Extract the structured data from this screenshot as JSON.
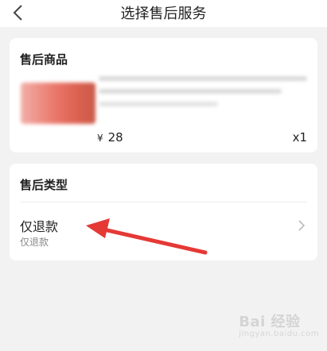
{
  "nav": {
    "back_icon": "chevron-left-icon",
    "title": "选择售后服务"
  },
  "goods": {
    "section_title": "售后商品",
    "currency": "¥",
    "price": "28",
    "quantity": "x1"
  },
  "service_type": {
    "section_title": "售后类型",
    "option_label": "仅退款",
    "option_sublabel": "仅退款",
    "chevron_icon": "chevron-right-icon"
  },
  "annotation": {
    "arrow_color": "#e53935"
  },
  "watermark": {
    "text": "Bai 经验",
    "sub": "jingyan.baidu.com"
  }
}
